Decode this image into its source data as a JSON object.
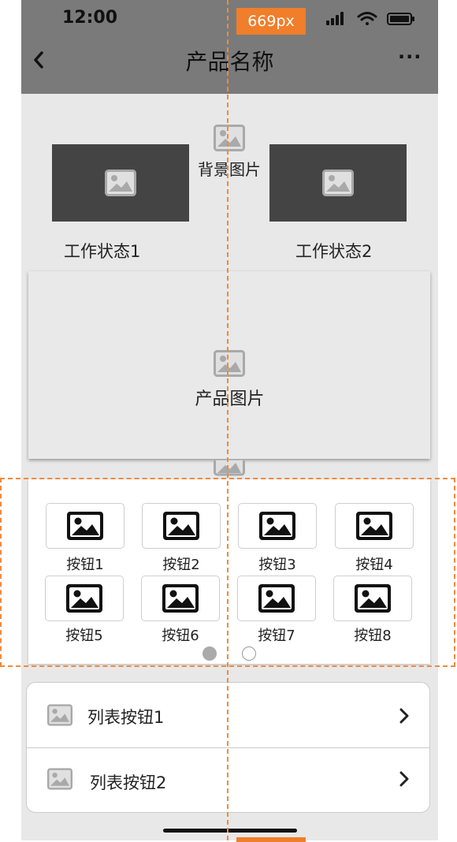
{
  "status_bar": {
    "time": "12:00"
  },
  "nav": {
    "title": "产品名称",
    "back_icon": "chevron-left-icon",
    "more_label": "···"
  },
  "background_image": {
    "label": "背景图片",
    "icon": "image-placeholder-icon"
  },
  "work_states": [
    {
      "label": "工作状态1"
    },
    {
      "label": "工作状态2"
    }
  ],
  "product_image": {
    "label": "产品图片"
  },
  "buttons": [
    {
      "label": "按钮1"
    },
    {
      "label": "按钮2"
    },
    {
      "label": "按钮3"
    },
    {
      "label": "按钮4"
    },
    {
      "label": "按钮5"
    },
    {
      "label": "按钮6"
    },
    {
      "label": "按钮7"
    },
    {
      "label": "按钮8"
    }
  ],
  "pager": {
    "page_count": 2,
    "active_index": 0
  },
  "list": [
    {
      "label": "列表按钮1"
    },
    {
      "label": "列表按钮2"
    }
  ],
  "guides": {
    "measure_label": "669px"
  },
  "colors": {
    "guide": "#f07e2a",
    "header": "#7a7a7a",
    "page_bg": "#e8e8e8",
    "dark_card": "#444444"
  }
}
